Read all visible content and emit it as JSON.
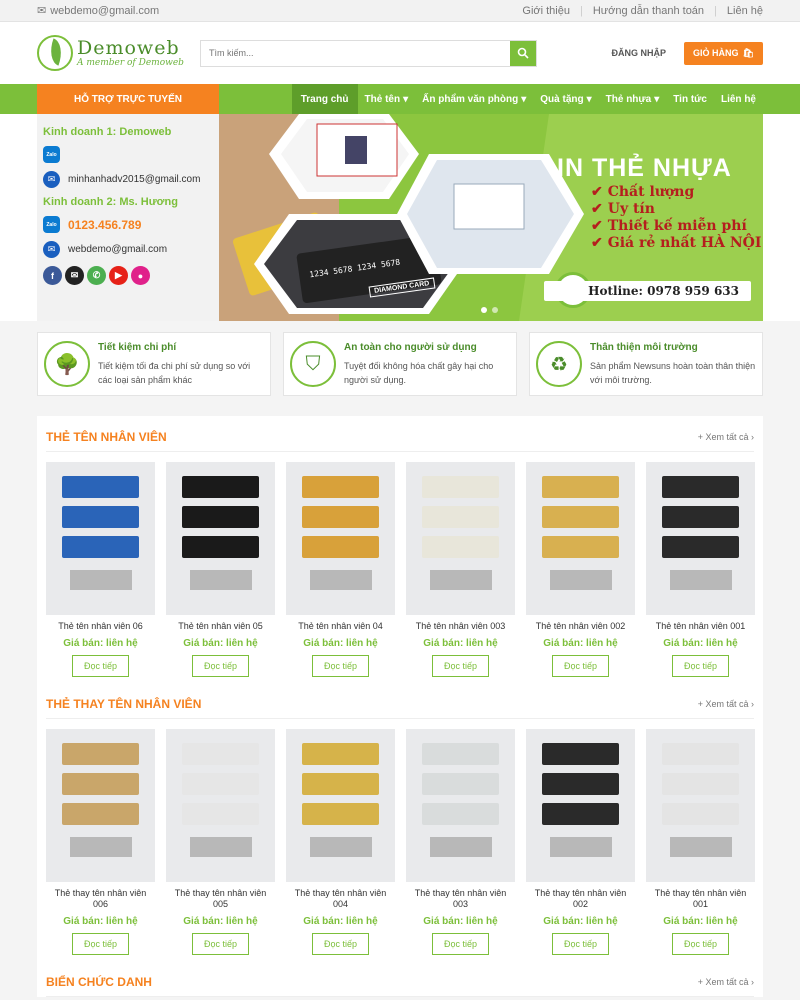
{
  "topbar": {
    "email": "webdemo@gmail.com",
    "links": [
      "Giới thiệu",
      "Hướng dẫn thanh toán",
      "Liên hệ"
    ]
  },
  "header": {
    "logo_name": "Demoweb",
    "logo_tagline": "A member of Demoweb",
    "search_placeholder": "Tìm kiếm...",
    "login": "ĐĂNG NHẬP",
    "cart": "GIỎ HÀNG"
  },
  "nav": {
    "support": "HỖ TRỢ TRỰC TUYẾN",
    "items": [
      "Trang chủ",
      "Thẻ tên",
      "Ấn phẩm văn phòng",
      "Quà tặng",
      "Thẻ nhựa",
      "Tin tức",
      "Liên hệ"
    ]
  },
  "contact": {
    "sales1": "Kinh doanh 1: Demoweb",
    "sales1_email": "minhanhadv2015@gmail.com",
    "sales2": "Kinh doanh 2: Ms. Hương",
    "sales2_phone": "0123.456.789",
    "sales2_email": "webdemo@gmail.com",
    "zalo_label": "Zalo"
  },
  "banner": {
    "title": "IN THẺ NHỰA",
    "bullets": [
      "Chất lượng",
      "Uy tín",
      "Thiết kế miễn phí",
      "Giá rẻ nhất HÀ NỘI"
    ],
    "hotline": "Hotline: 0978 959 633",
    "card_text": "DIAMOND CARD",
    "card_number": "1234 5678 1234 5678"
  },
  "features": [
    {
      "title": "Tiết kiệm chi phí",
      "text": "Tiết kiệm tối đa chi phí sử dụng so với các loại sản phẩm khác"
    },
    {
      "title": "An toàn cho người sử dụng",
      "text": "Tuyệt đối không hóa chất gây hại cho người sử dụng."
    },
    {
      "title": "Thân thiện môi trường",
      "text": "Sản phẩm Newsuns hoàn toàn thân thiện với môi trường."
    }
  ],
  "sections": [
    {
      "title": "THẺ TÊN NHÂN VIÊN",
      "more": "+ Xem tất cả",
      "products": [
        {
          "name": "Thẻ tên nhân viên 06",
          "price": "Giá bán: liên hệ",
          "button": "Đọc tiếp",
          "color": "#2a64b8"
        },
        {
          "name": "Thẻ tên nhân viên 05",
          "price": "Giá bán: liên hệ",
          "button": "Đọc tiếp",
          "color": "#1a1a1a"
        },
        {
          "name": "Thẻ tên nhân viên 04",
          "price": "Giá bán: liên hệ",
          "button": "Đọc tiếp",
          "color": "#d8a13a"
        },
        {
          "name": "Thẻ tên nhân viên 003",
          "price": "Giá bán: liên hệ",
          "button": "Đọc tiếp",
          "color": "#e8e6da"
        },
        {
          "name": "Thẻ tên nhân viên 002",
          "price": "Giá bán: liên hệ",
          "button": "Đọc tiếp",
          "color": "#d8b050"
        },
        {
          "name": "Thẻ tên nhân viên 001",
          "price": "Giá bán: liên hệ",
          "button": "Đọc tiếp",
          "color": "#2a2a2a"
        }
      ]
    },
    {
      "title": "THẺ THAY TÊN NHÂN VIÊN",
      "more": "+ Xem tất cả",
      "products": [
        {
          "name": "Thẻ thay tên nhân viên 006",
          "price": "Giá bán: liên hệ",
          "button": "Đọc tiếp",
          "color": "#c9a66a"
        },
        {
          "name": "Thẻ thay tên nhân viên 005",
          "price": "Giá bán: liên hệ",
          "button": "Đọc tiếp",
          "color": "#e6e6e6"
        },
        {
          "name": "Thẻ thay tên nhân viên 004",
          "price": "Giá bán: liên hệ",
          "button": "Đọc tiếp",
          "color": "#d6b34a"
        },
        {
          "name": "Thẻ thay tên nhân viên 003",
          "price": "Giá bán: liên hệ",
          "button": "Đọc tiếp",
          "color": "#d9dcdc"
        },
        {
          "name": "Thẻ thay tên nhân viên 002",
          "price": "Giá bán: liên hệ",
          "button": "Đọc tiếp",
          "color": "#2a2a2a"
        },
        {
          "name": "Thẻ thay tên nhân viên 001",
          "price": "Giá bán: liên hệ",
          "button": "Đọc tiếp",
          "color": "#e4e4e4"
        }
      ]
    },
    {
      "title": "BIỂN CHỨC DANH",
      "more": "+ Xem tất cả",
      "products": []
    }
  ]
}
